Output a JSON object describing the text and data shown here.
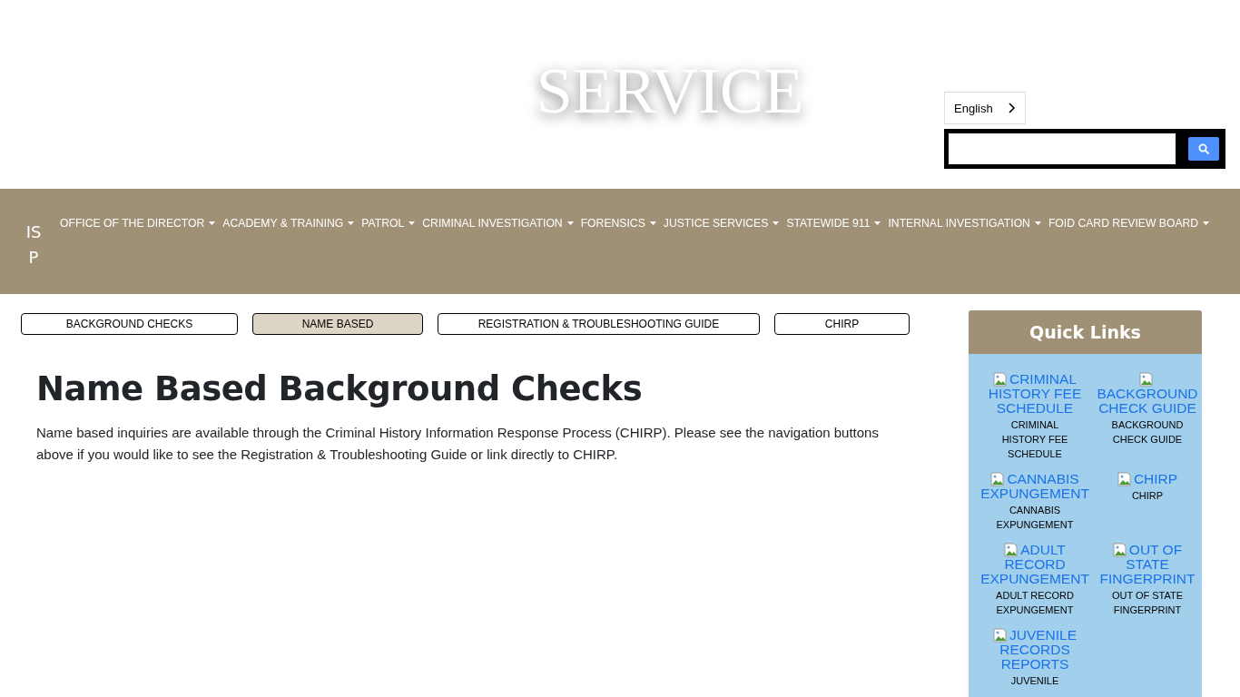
{
  "header": {
    "title": "SERVICE",
    "language": "English"
  },
  "nav": {
    "logo": "ISP",
    "items": [
      "OFFICE OF THE DIRECTOR",
      "ACADEMY & TRAINING",
      "PATROL",
      "CRIMINAL INVESTIGATION",
      "FORENSICS",
      "JUSTICE SERVICES",
      "STATEWIDE 911",
      "INTERNAL INVESTIGATION",
      "FOID CARD REVIEW BOARD"
    ]
  },
  "tabs": [
    {
      "label": "BACKGROUND CHECKS",
      "selected": false
    },
    {
      "label": "NAME BASED",
      "selected": true
    },
    {
      "label": "REGISTRATION & TROUBLESHOOTING GUIDE",
      "selected": false
    },
    {
      "label": "CHIRP",
      "selected": false
    }
  ],
  "heading": "Name Based Background Checks",
  "body": "Name based inquiries are available through the Criminal History Information Response Process (CHIRP). Please see the navigation buttons above if you would like to see the Registration & Troubleshooting Guide or link directly to CHIRP.",
  "quick_links": {
    "title": "Quick Links",
    "items": [
      {
        "link": "CRIMINAL HISTORY FEE SCHEDULE",
        "caption": "CRIMINAL HISTORY FEE SCHEDULE"
      },
      {
        "link": "BACKGROUND CHECK GUIDE",
        "caption": "BACKGROUND CHECK GUIDE"
      },
      {
        "link": "CANNABIS EXPUNGEMENT",
        "caption": "CANNABIS EXPUNGEMENT"
      },
      {
        "link": "CHIRP",
        "caption": "CHIRP"
      },
      {
        "link": "ADULT RECORD EXPUNGEMENT",
        "caption": "ADULT RECORD EXPUNGEMENT"
      },
      {
        "link": "OUT OF STATE FINGERPRINT",
        "caption": "OUT OF STATE FINGERPRINT"
      },
      {
        "link": "JUVENILE RECORDS REPORTS",
        "caption": "JUVENILE"
      }
    ]
  }
}
